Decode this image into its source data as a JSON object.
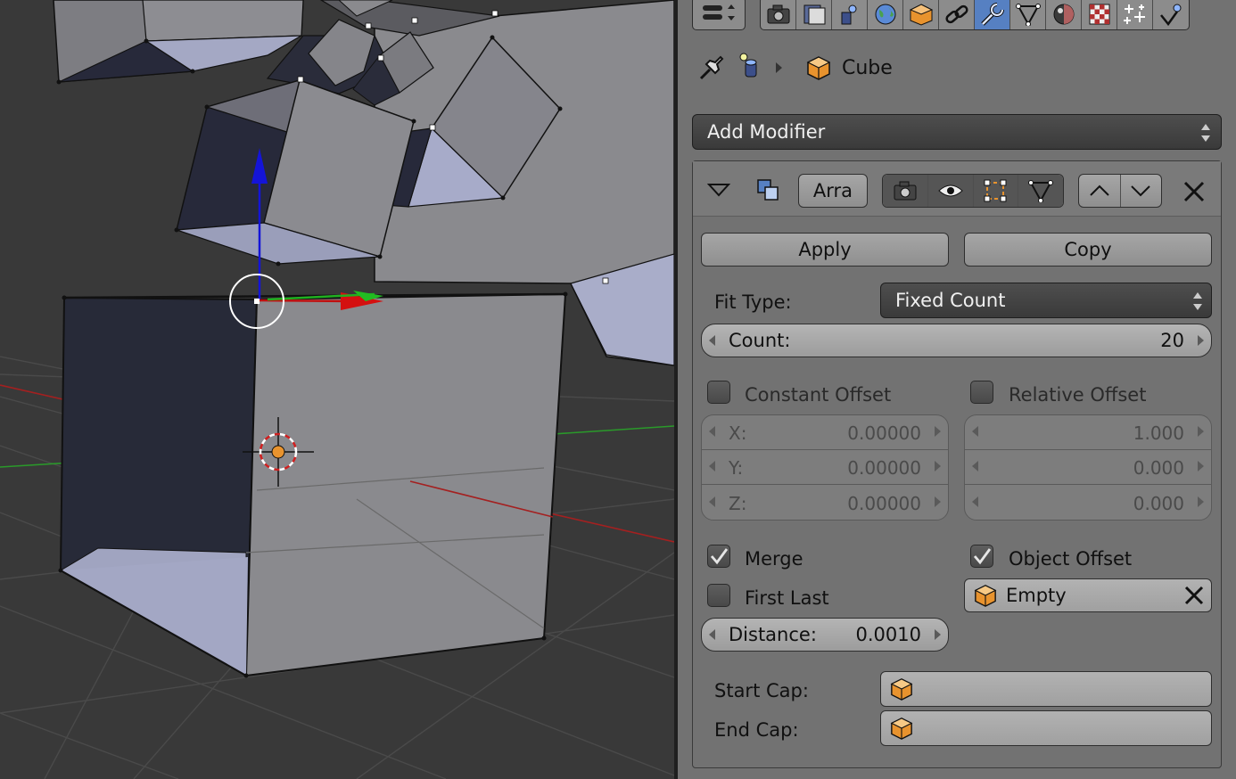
{
  "header": {
    "tabs": [
      "render-icon",
      "render-layers-icon",
      "scene-icon",
      "world-icon",
      "object-icon",
      "constraints-icon",
      "modifiers-icon",
      "data-icon",
      "material-icon",
      "texture-icon",
      "particles-icon",
      "physics-icon"
    ],
    "active_tab": "modifiers-icon"
  },
  "breadcrumb": {
    "object_name": "Cube"
  },
  "add_modifier": {
    "label": "Add Modifier"
  },
  "modifier": {
    "name": "Arra",
    "apply_label": "Apply",
    "copy_label": "Copy",
    "fit_type_label": "Fit Type:",
    "fit_type_value": "Fixed Count",
    "count_label": "Count:",
    "count_value": "20",
    "constant_offset": {
      "label": "Constant Offset",
      "checked": false,
      "x_label": "X:",
      "x_value": "0.00000",
      "y_label": "Y:",
      "y_value": "0.00000",
      "z_label": "Z:",
      "z_value": "0.00000"
    },
    "relative_offset": {
      "label": "Relative Offset",
      "checked": false,
      "x_value": "1.000",
      "y_value": "0.000",
      "z_value": "0.000"
    },
    "merge": {
      "label": "Merge",
      "checked": true
    },
    "first_last": {
      "label": "First Last",
      "checked": false
    },
    "distance_label": "Distance:",
    "distance_value": "0.0010",
    "object_offset": {
      "label": "Object Offset",
      "checked": true,
      "object": "Empty"
    },
    "start_cap_label": "Start Cap:",
    "end_cap_label": "End Cap:"
  },
  "colors": {
    "active_tab": "#5680c2",
    "panel_bg": "#727272",
    "viewport_bg": "#393939",
    "x_axis": "#b02020",
    "y_axis": "#2a9a2a",
    "z_axis": "#1010e0",
    "object_icon": "#e8932e"
  }
}
